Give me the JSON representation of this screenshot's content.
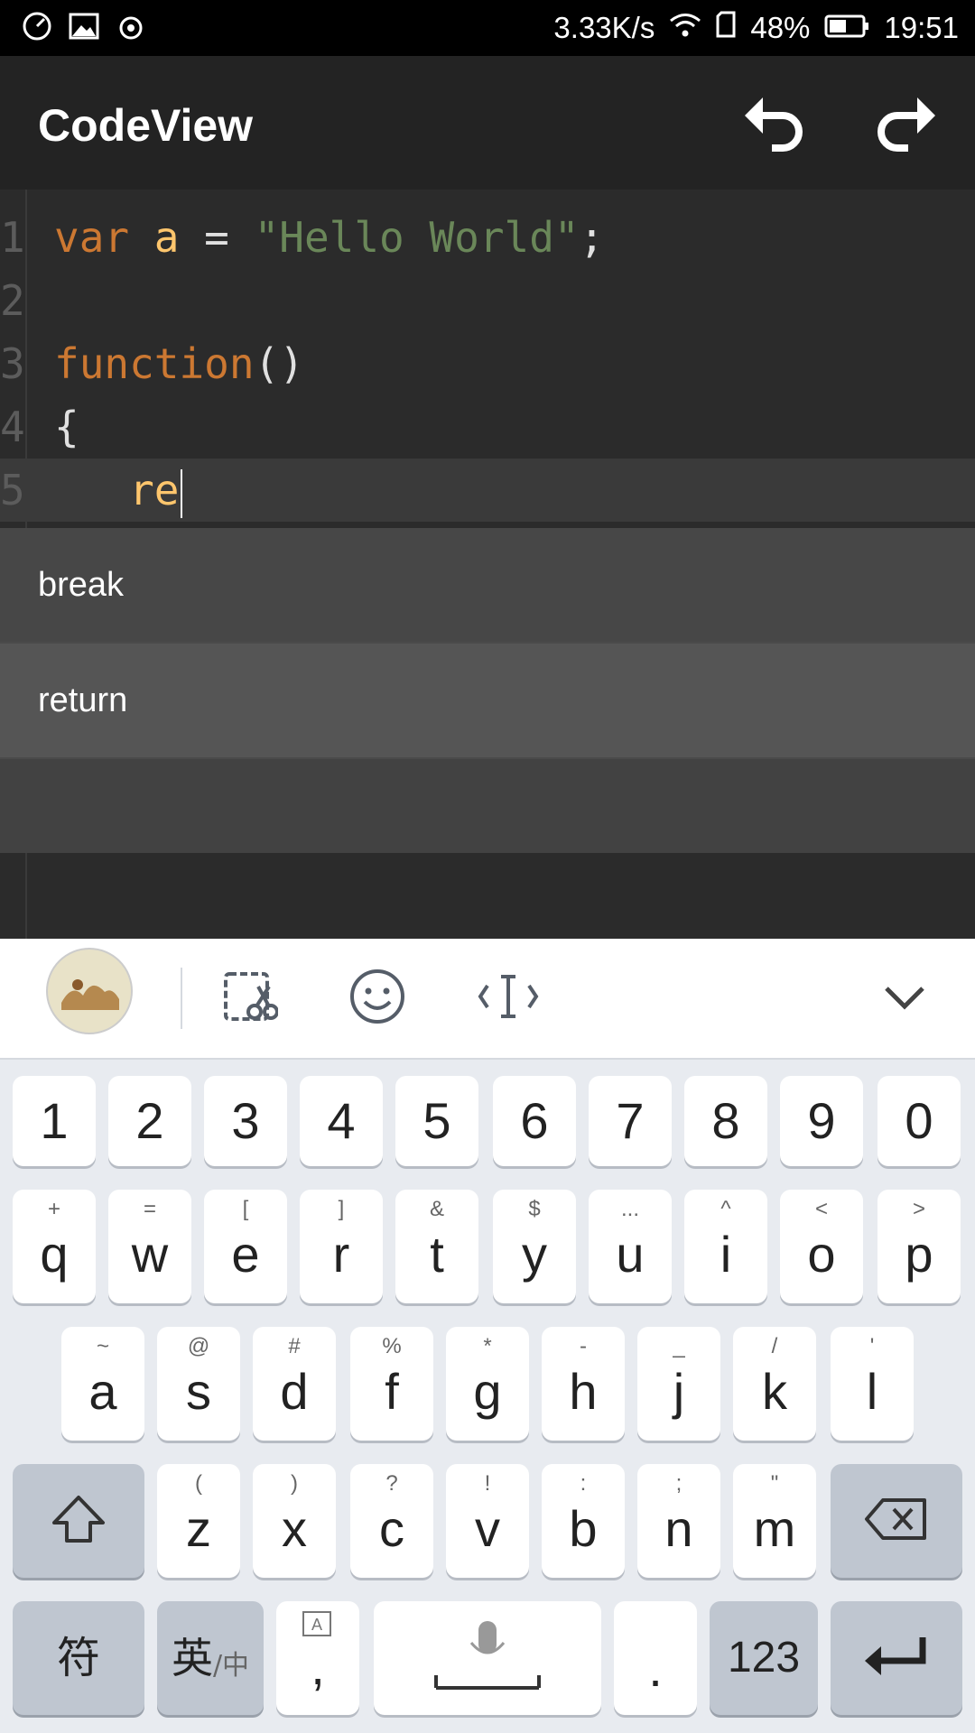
{
  "status_bar": {
    "network_speed": "3.33K/s",
    "battery": "48%",
    "time": "19:51",
    "icons": [
      "speedometer-icon",
      "image-icon",
      "weibo-icon",
      "wifi-icon",
      "sim-icon",
      "battery-icon"
    ]
  },
  "app_bar": {
    "title": "CodeView",
    "undo_icon": "undo-icon",
    "redo_icon": "redo-icon"
  },
  "editor": {
    "lines": [
      {
        "num": "1",
        "tokens": [
          {
            "t": "var ",
            "c": "kw"
          },
          {
            "t": "a",
            "c": "var"
          },
          {
            "t": " = ",
            "c": "plain"
          },
          {
            "t": "\"Hello World\"",
            "c": "str"
          },
          {
            "t": ";",
            "c": "plain"
          }
        ]
      },
      {
        "num": "2",
        "tokens": []
      },
      {
        "num": "3",
        "tokens": [
          {
            "t": "function",
            "c": "kw"
          },
          {
            "t": "()",
            "c": "plain"
          }
        ]
      },
      {
        "num": "4",
        "tokens": [
          {
            "t": "{",
            "c": "plain"
          }
        ]
      },
      {
        "num": "5",
        "tokens": [
          {
            "t": "   re",
            "c": "var"
          }
        ]
      }
    ],
    "current_line": 5
  },
  "autocomplete": {
    "items": [
      "break",
      "return"
    ]
  },
  "keyboard": {
    "toolbar_icons": [
      "avatar",
      "clipboard-cut-icon",
      "emoji-icon",
      "cursor-move-icon",
      "collapse-chevron-icon"
    ],
    "number_row": [
      "1",
      "2",
      "3",
      "4",
      "5",
      "6",
      "7",
      "8",
      "9",
      "0"
    ],
    "row1": [
      {
        "k": "q",
        "s": "+"
      },
      {
        "k": "w",
        "s": "="
      },
      {
        "k": "e",
        "s": "["
      },
      {
        "k": "r",
        "s": "]"
      },
      {
        "k": "t",
        "s": "&"
      },
      {
        "k": "y",
        "s": "$"
      },
      {
        "k": "u",
        "s": "..."
      },
      {
        "k": "i",
        "s": "^"
      },
      {
        "k": "o",
        "s": "<"
      },
      {
        "k": "p",
        "s": ">"
      }
    ],
    "row2": [
      {
        "k": "a",
        "s": "~"
      },
      {
        "k": "s",
        "s": "@"
      },
      {
        "k": "d",
        "s": "#"
      },
      {
        "k": "f",
        "s": "%"
      },
      {
        "k": "g",
        "s": "*"
      },
      {
        "k": "h",
        "s": "-"
      },
      {
        "k": "j",
        "s": "_"
      },
      {
        "k": "k",
        "s": "/"
      },
      {
        "k": "l",
        "s": "'"
      }
    ],
    "row3": [
      {
        "k": "z",
        "s": "("
      },
      {
        "k": "x",
        "s": ")"
      },
      {
        "k": "c",
        "s": "?"
      },
      {
        "k": "v",
        "s": "!"
      },
      {
        "k": "b",
        "s": ":"
      },
      {
        "k": "n",
        "s": ";"
      },
      {
        "k": "m",
        "s": "\""
      }
    ],
    "bottom": {
      "symbols": "符",
      "lang_main": "英",
      "lang_sub": "/中",
      "comma": ",",
      "period": ".",
      "numbers": "123"
    }
  }
}
